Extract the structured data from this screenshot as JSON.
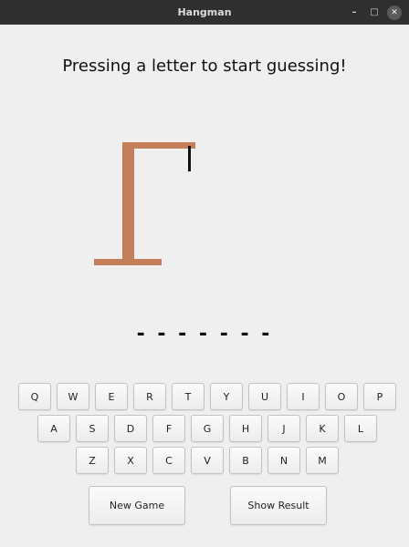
{
  "window": {
    "title": "Hangman",
    "controls": [
      "minimize-icon",
      "maximize-icon",
      "close-icon"
    ]
  },
  "message": "Pressing a letter to start guessing!",
  "gallows": {
    "color": "#c47e5a",
    "rope_color": "#111111"
  },
  "word": {
    "display": "- - - - - - -",
    "blank_count": 7
  },
  "keyboard": {
    "rows": [
      [
        "Q",
        "W",
        "E",
        "R",
        "T",
        "Y",
        "U",
        "I",
        "O",
        "P"
      ],
      [
        "A",
        "S",
        "D",
        "F",
        "G",
        "H",
        "J",
        "K",
        "L"
      ],
      [
        "Z",
        "X",
        "C",
        "V",
        "B",
        "N",
        "M"
      ]
    ]
  },
  "buttons": {
    "new_game": "New Game",
    "show_result": "Show Result"
  }
}
